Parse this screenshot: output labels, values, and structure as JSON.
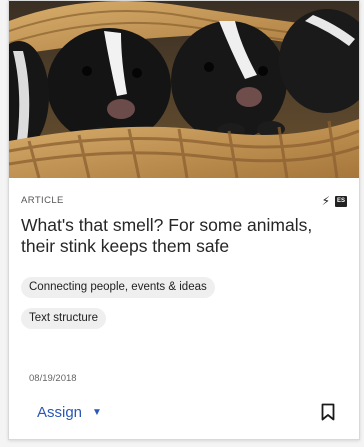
{
  "card": {
    "type_label": "ARTICLE",
    "title": "What's that smell? For some animals, their stink keeps them safe",
    "tags": [
      "Connecting people, events & ideas",
      "Text structure"
    ],
    "date": "08/19/2018",
    "assign_label": "Assign",
    "icons": {
      "hero": "skunks-in-basket-photo",
      "power": "lightning-bolt-icon",
      "language": "es-language-badge-icon",
      "caret": "caret-down-icon",
      "bookmark": "bookmark-icon"
    },
    "colors": {
      "accent": "#2a58b5",
      "chip_bg": "#efefef",
      "title": "#262626"
    }
  }
}
